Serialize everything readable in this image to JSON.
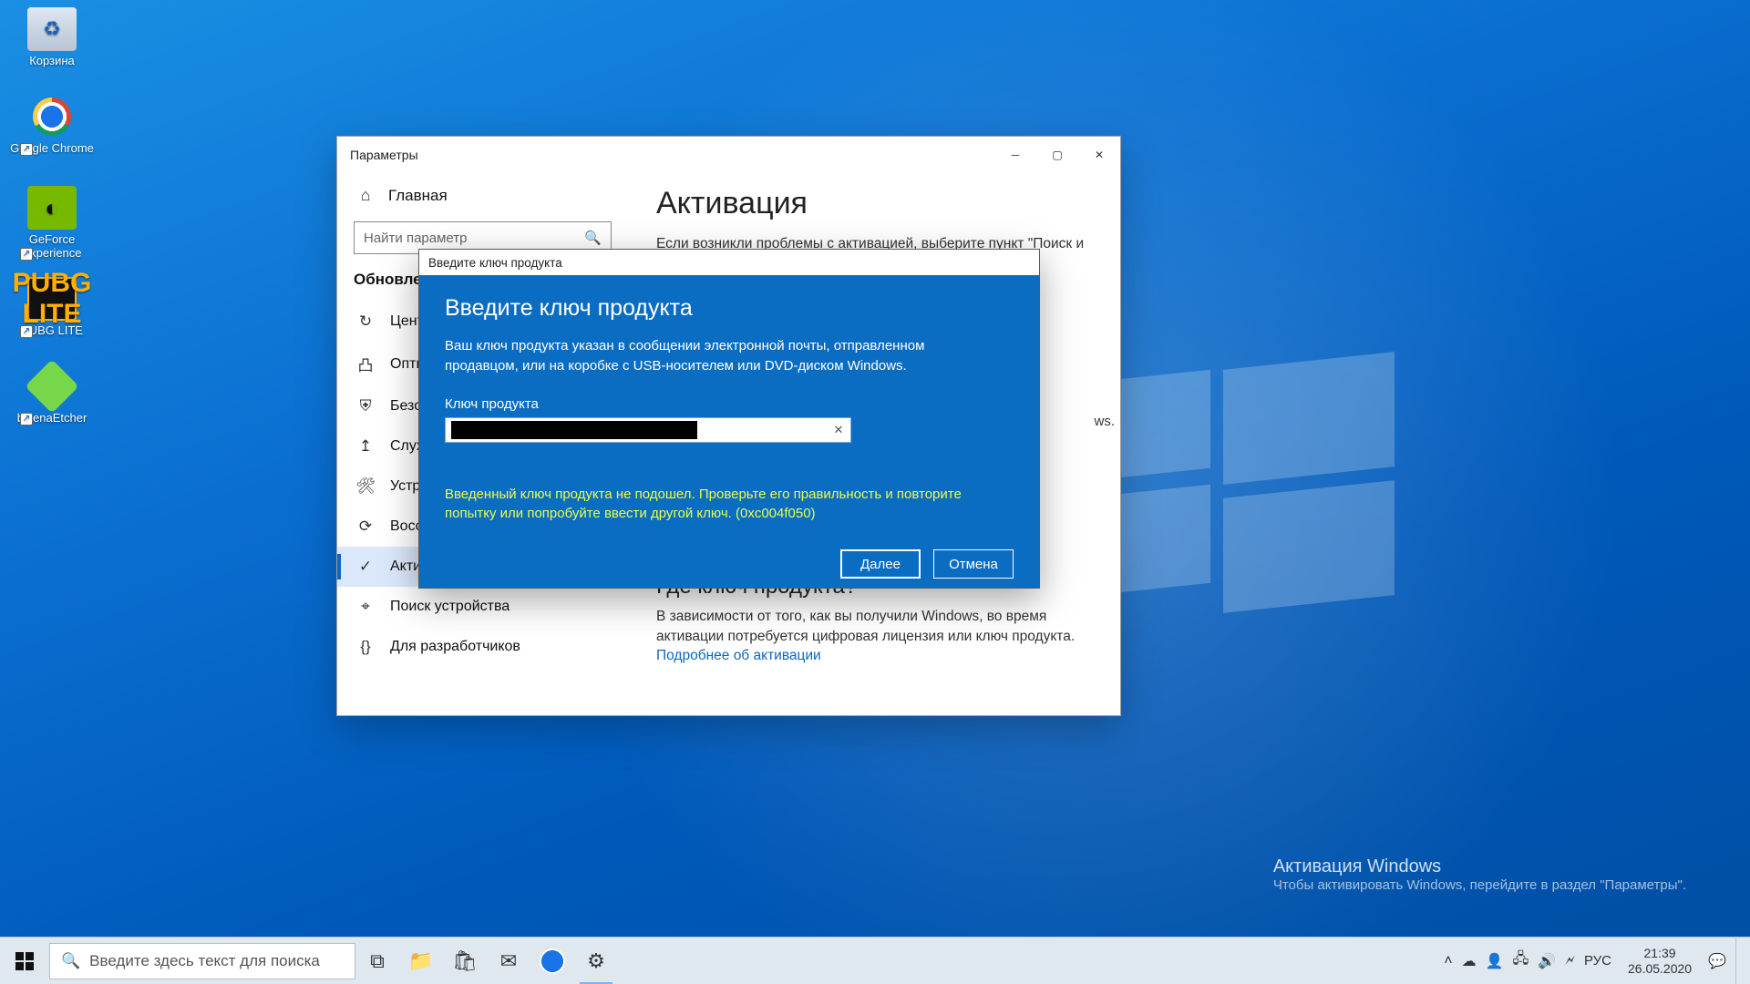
{
  "desktop_icons": [
    {
      "label": "Корзина"
    },
    {
      "label": "Google Chrome"
    },
    {
      "label": "GeForce Experience"
    },
    {
      "label": "PUBG LITE"
    },
    {
      "label": "balenaEtcher"
    }
  ],
  "watermark": {
    "title": "Активация Windows",
    "sub": "Чтобы активировать Windows, перейдите в раздел \"Параметры\"."
  },
  "settings": {
    "title": "Параметры",
    "home": "Главная",
    "search_placeholder": "Найти параметр",
    "section_header": "Обновление и безопасность",
    "nav": [
      {
        "icon": "↻",
        "label": "Центр обновления Windows"
      },
      {
        "icon": "凸",
        "label": "Оптимизация доставки"
      },
      {
        "icon": "⛨",
        "label": "Безопасность Windows"
      },
      {
        "icon": "↥",
        "label": "Служба архивации"
      },
      {
        "icon": "🛠",
        "label": "Устранение неполадок"
      },
      {
        "icon": "⟳",
        "label": "Восстановление"
      },
      {
        "icon": "✓",
        "label": "Активация",
        "active": true
      },
      {
        "icon": "⌖",
        "label": "Поиск устройства"
      },
      {
        "icon": "{}",
        "label": "Для разработчиков"
      }
    ],
    "pane": {
      "heading": "Активация",
      "intro": "Если возникли проблемы с активацией, выберите пункт \"Поиск и устранение неполадок\", чтобы попытаться устранить их.",
      "edition_suffix": "ws.",
      "sec2_h": "Где ключ продукта?",
      "sec2_p": "В зависимости от того, как вы получили Windows, во время активации потребуется цифровая лицензия или ключ продукта.",
      "link": "Подробнее об активации"
    }
  },
  "modal": {
    "titlebar": "Введите ключ продукта",
    "heading": "Введите ключ продукта",
    "desc": "Ваш ключ продукта указан в сообщении электронной почты, отправленном продавцом, или на коробке с USB-носителем или DVD-диском Windows.",
    "field_label": "Ключ продукта",
    "error": "Введенный ключ продукта не подошел. Проверьте его правильность и повторите попытку или попробуйте ввести другой ключ. (0xc004f050)",
    "next_btn": "Далее",
    "cancel_btn": "Отмена"
  },
  "taskbar": {
    "search_placeholder": "Введите здесь текст для поиска",
    "lang": "РУС",
    "time": "21:39",
    "date": "26.05.2020"
  }
}
